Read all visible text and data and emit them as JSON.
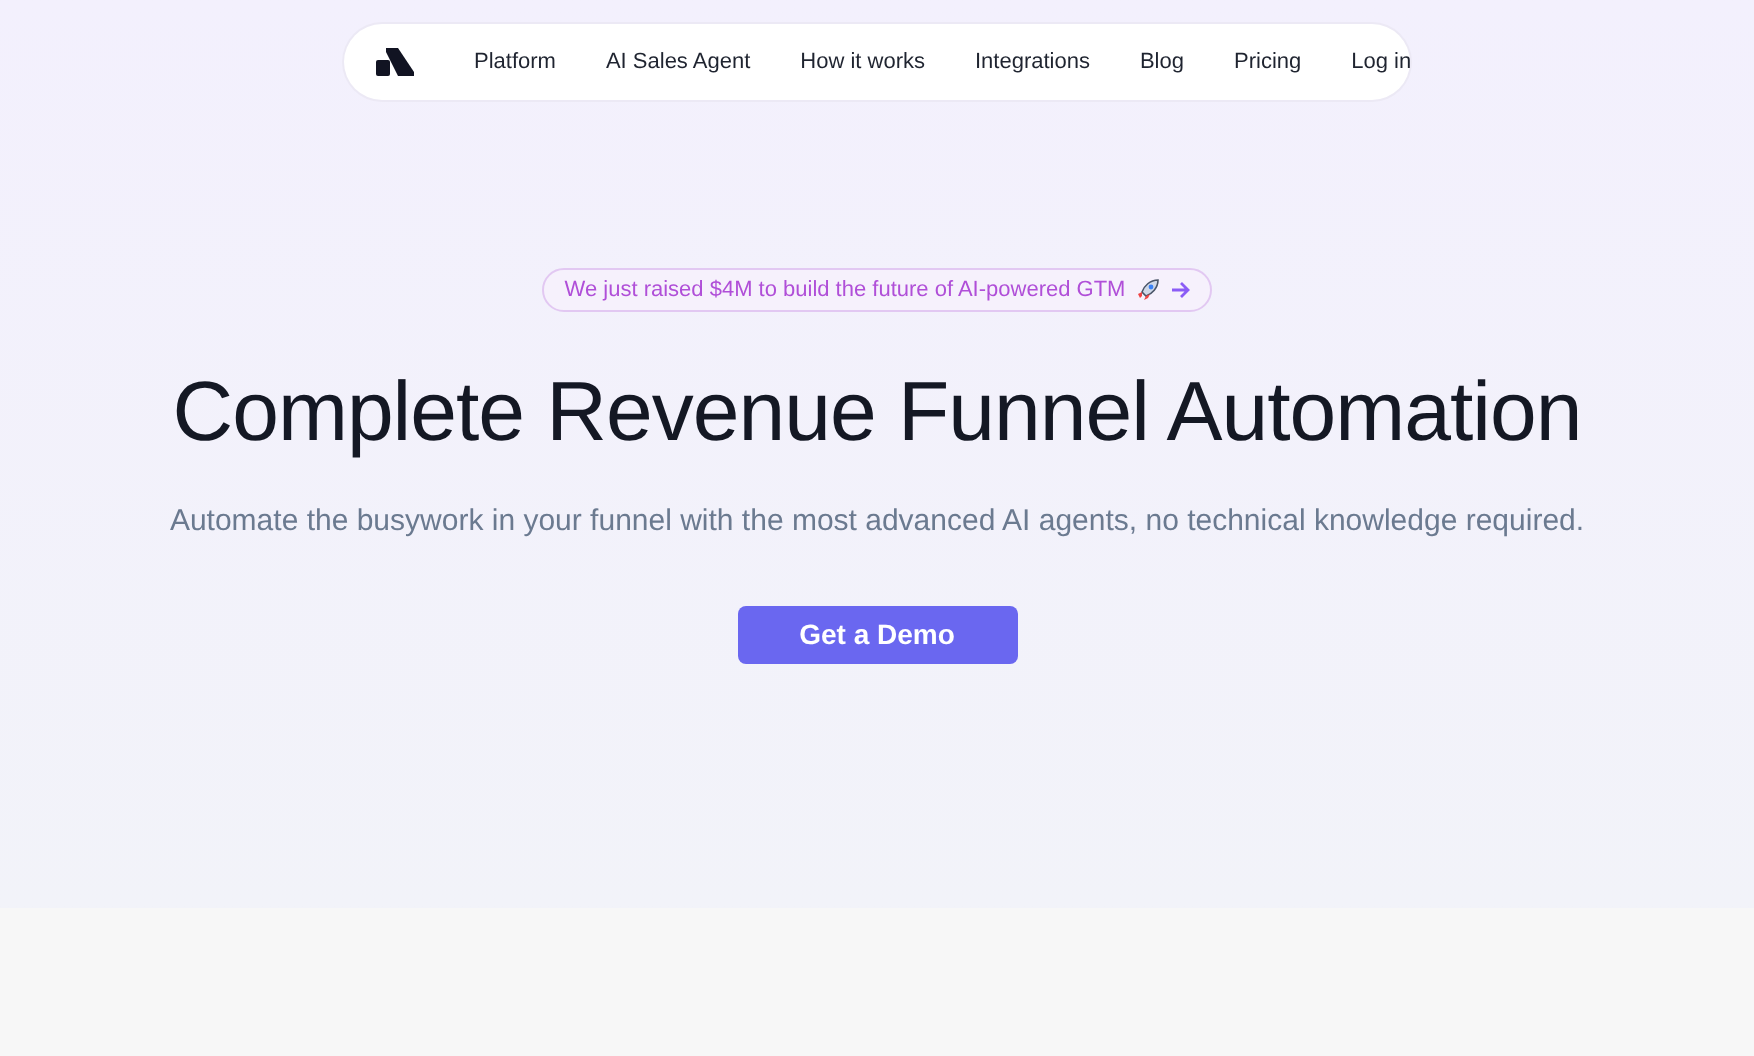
{
  "nav": {
    "links": [
      "Platform",
      "AI Sales Agent",
      "How it works",
      "Integrations",
      "Blog",
      "Pricing",
      "Log in"
    ]
  },
  "hero": {
    "announcement": "We just raised $4M to build the future of AI-powered GTM",
    "title": "Complete Revenue Funnel Automation",
    "subtitle": "Automate the busywork in your funnel with the most advanced AI agents, no technical knowledge required.",
    "cta": "Get a Demo"
  }
}
